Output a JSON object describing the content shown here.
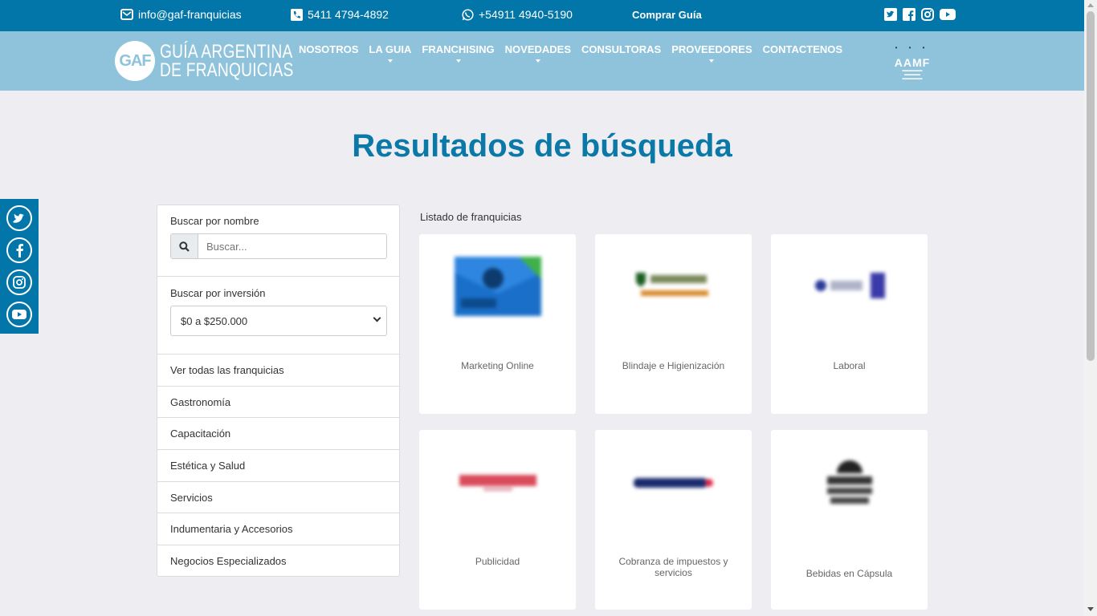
{
  "topbar": {
    "email": "info@gaf-franquicias",
    "phone": "5411 4794-4892",
    "whatsapp": "+54911 4940-5190",
    "buy": "Comprar Guía",
    "socials": [
      "twitter-icon",
      "facebook-icon",
      "instagram-icon",
      "youtube-icon"
    ]
  },
  "nav": {
    "logo_mark": "GAF",
    "logo_line1": "GUÍA ARGENTINA",
    "logo_line2": "DE FRANQUICIAS",
    "items": [
      {
        "label": "NOSOTROS",
        "dropdown": false
      },
      {
        "label": "LA GUIA",
        "dropdown": true
      },
      {
        "label": "FRANCHISING",
        "dropdown": true
      },
      {
        "label": "NOVEDADES",
        "dropdown": true
      },
      {
        "label": "CONSULTORAS",
        "dropdown": false
      },
      {
        "label": "PROVEEDORES",
        "dropdown": true
      },
      {
        "label": "CONTACTENOS",
        "dropdown": false
      }
    ],
    "partner_logo": "AAMF"
  },
  "page": {
    "title": "Resultados de búsqueda"
  },
  "filter": {
    "name_label": "Buscar por nombre",
    "search_placeholder": "Buscar...",
    "investment_label": "Buscar por inversión",
    "investment_selected": "$0 a $250.000",
    "categories": [
      "Ver todas las franquicias",
      "Gastronomía",
      "Capacitación",
      "Estética y Salud",
      "Servicios",
      "Indumentaria y Accesorios",
      "Negocios Especializados"
    ]
  },
  "listing": {
    "title": "Listado de franquicias",
    "cards": [
      {
        "category": "Marketing Online"
      },
      {
        "category": "Blindaje e Higienización"
      },
      {
        "category": "Laboral"
      },
      {
        "category": "Publicidad"
      },
      {
        "category": "Cobranza de impuestos y servicios"
      },
      {
        "category": "Bebidas en Cápsula"
      }
    ]
  },
  "colors": {
    "topbar": "#0276a8",
    "navbar": "#8fc3dc",
    "title": "#0b79a8",
    "background": "#eeedf1"
  }
}
